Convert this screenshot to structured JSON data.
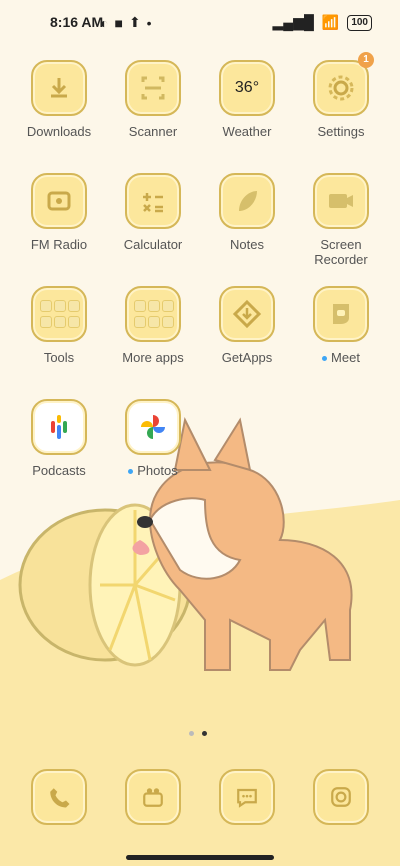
{
  "status": {
    "time": "8:16 AM",
    "battery": "100"
  },
  "apps": [
    {
      "label": "Downloads"
    },
    {
      "label": "Scanner"
    },
    {
      "label": "Weather",
      "temp": "36°"
    },
    {
      "label": "Settings",
      "badge": "1"
    },
    {
      "label": "FM Radio"
    },
    {
      "label": "Calculator"
    },
    {
      "label": "Notes"
    },
    {
      "label": "Screen\nRecorder"
    },
    {
      "label": "Tools"
    },
    {
      "label": "More apps"
    },
    {
      "label": "GetApps"
    },
    {
      "label": "Meet"
    },
    {
      "label": "Podcasts"
    },
    {
      "label": "Photos"
    }
  ]
}
